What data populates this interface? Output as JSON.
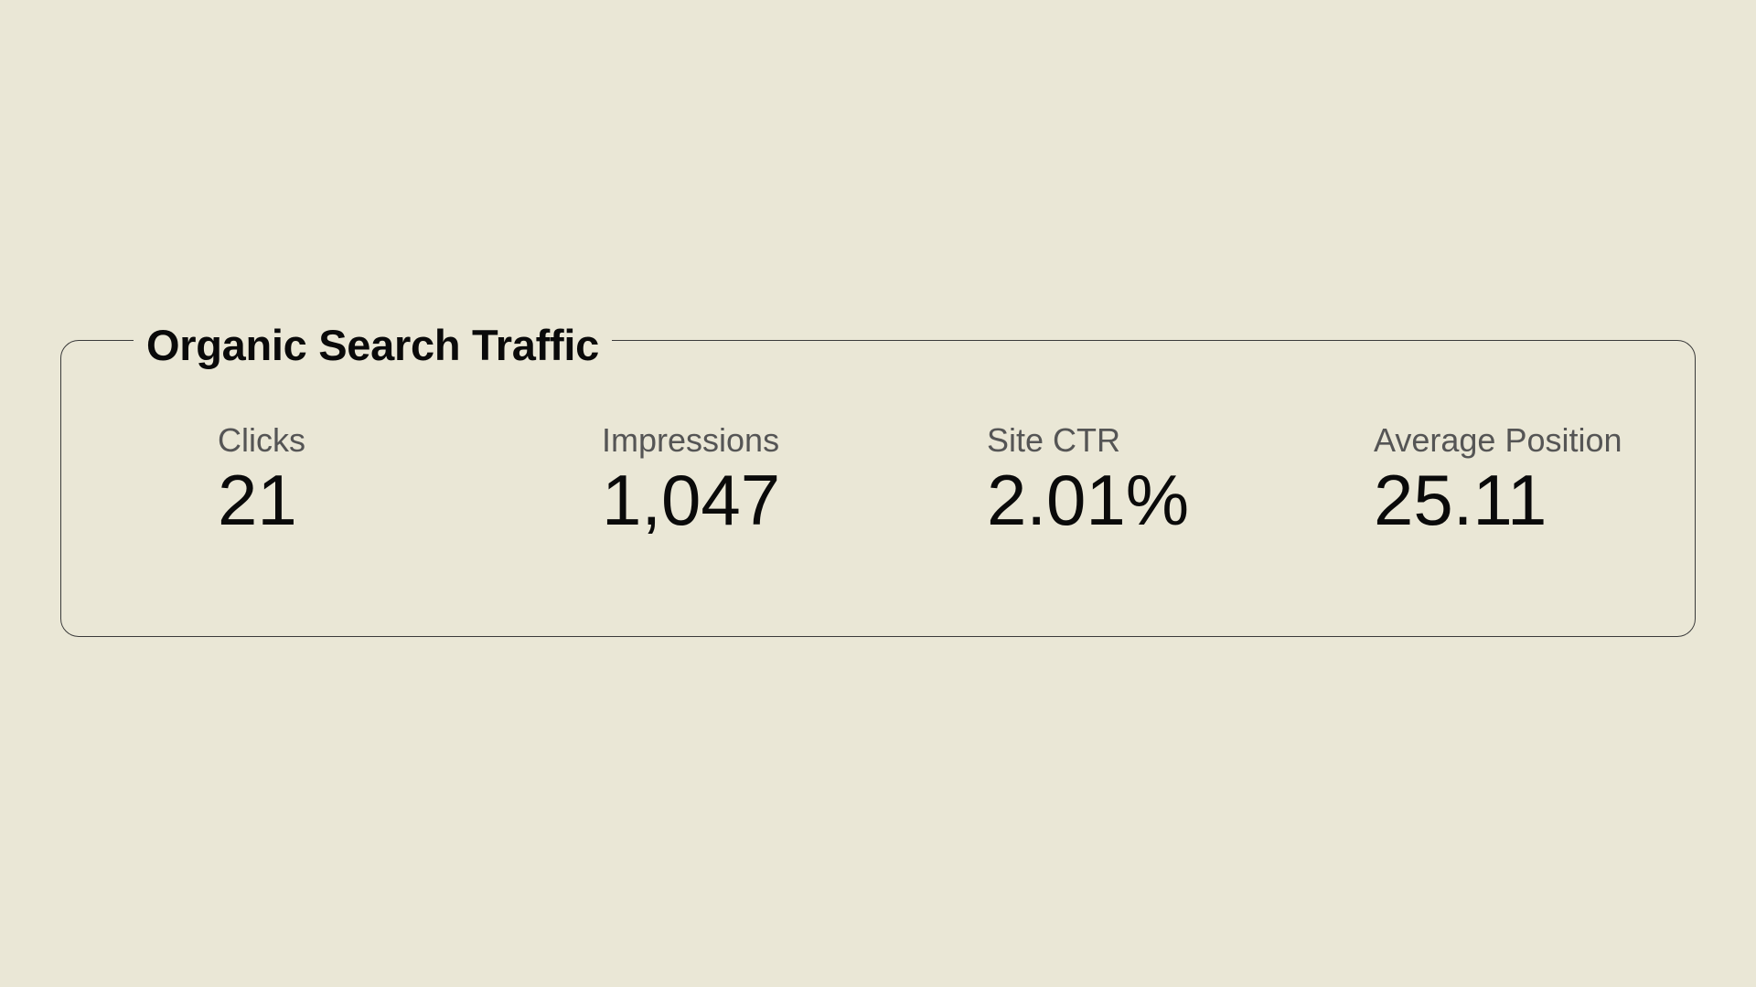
{
  "card": {
    "title": "Organic Search Traffic",
    "metrics": [
      {
        "label": "Clicks",
        "value": "21"
      },
      {
        "label": "Impressions",
        "value": "1,047"
      },
      {
        "label": "Site CTR",
        "value": "2.01%"
      },
      {
        "label": "Average Position",
        "value": "25.11"
      }
    ]
  },
  "colors": {
    "background": "#EAE7D6",
    "border": "#3a3a3a",
    "label_text": "#555555",
    "value_text": "#0a0a0a"
  }
}
